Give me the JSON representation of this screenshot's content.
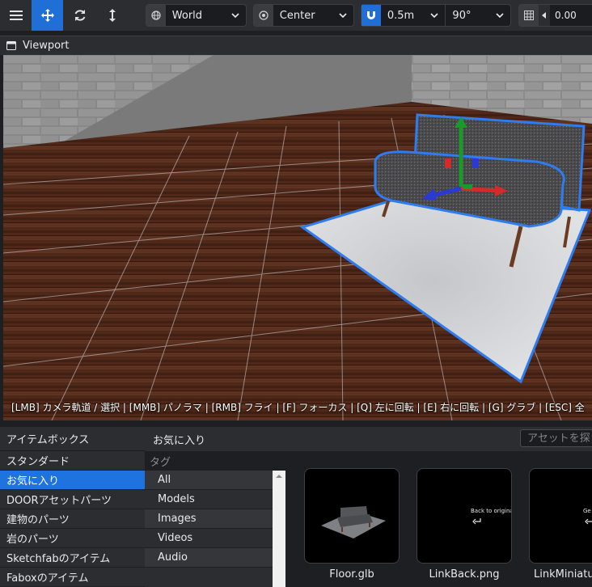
{
  "toolbar": {
    "space_select": "World",
    "pivot_select": "Center",
    "snap_move": "0.5m",
    "snap_rotate": "90°",
    "grid_value": "0.00"
  },
  "viewport": {
    "title": "Viewport",
    "hint": "[LMB] カメラ軌道 / 選択 | [MMB] パノラマ | [RMB] フライ | [F] フォーカス | [Q] 左に回転 | [E] 右に回転 | [G] グラブ | [ESC] 全"
  },
  "itembox": {
    "title": "アイテムボックス",
    "categories": [
      {
        "label": "スタンダード",
        "selected": false
      },
      {
        "label": "お気に入り",
        "selected": true
      },
      {
        "label": "DOORアセットパーツ",
        "selected": false
      },
      {
        "label": "建物のパーツ",
        "selected": false
      },
      {
        "label": "岩のパーツ",
        "selected": false
      },
      {
        "label": "Sketchfabのアイテム",
        "selected": false
      },
      {
        "label": "Faboxのアイテム",
        "selected": false
      }
    ]
  },
  "favorites": {
    "title": "お気に入り",
    "search_placeholder": "アセットを探",
    "tag_header": "タグ",
    "tags": [
      "All",
      "Models",
      "Images",
      "Videos",
      "Audio"
    ],
    "assets": [
      {
        "name": "Floor.glb",
        "caption": ""
      },
      {
        "name": "LinkBack.png",
        "caption": "Back to original"
      },
      {
        "name": "LinkMiniatur",
        "caption": "Ge"
      }
    ]
  },
  "colors": {
    "accent": "#1f73e0",
    "toolbar_bg": "#2b2d30",
    "panel_bg": "#1e1f22"
  }
}
